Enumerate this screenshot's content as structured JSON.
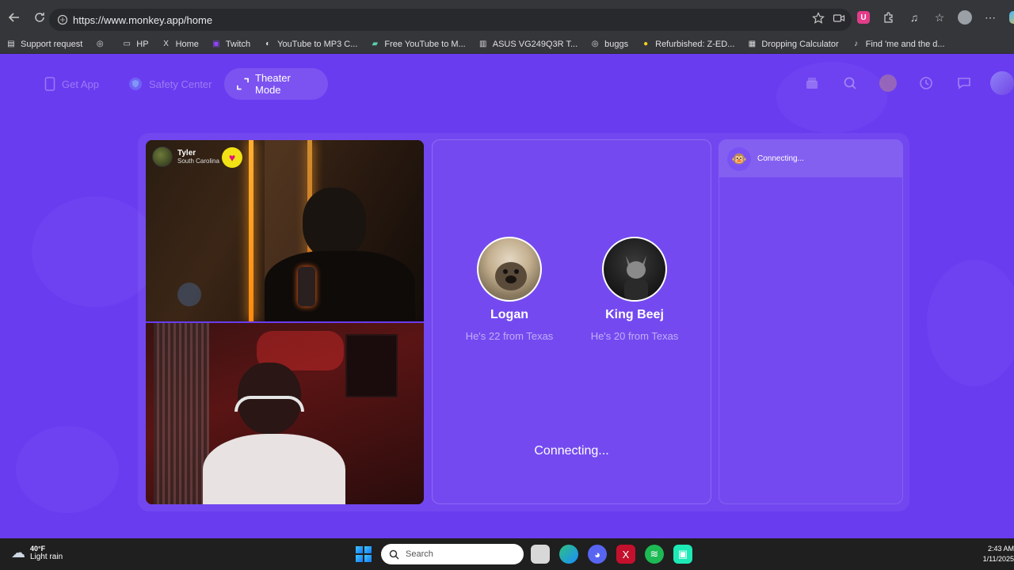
{
  "browser": {
    "url": "https://www.monkey.app/home",
    "bookmarks": [
      {
        "label": "Support request",
        "icon": "ticket-icon"
      },
      {
        "label": "",
        "icon": "globe-icon"
      },
      {
        "label": "HP",
        "icon": "folder-icon"
      },
      {
        "label": "Home",
        "icon": "x-logo-icon"
      },
      {
        "label": "Twitch",
        "icon": "twitch-icon"
      },
      {
        "label": "YouTube to MP3 C...",
        "icon": "converter-icon"
      },
      {
        "label": "Free YouTube to M...",
        "icon": "yt-icon"
      },
      {
        "label": "ASUS VG249Q3R T...",
        "icon": "asus-icon"
      },
      {
        "label": "buggs",
        "icon": "globe-icon"
      },
      {
        "label": "Refurbished: Z-ED...",
        "icon": "ebay-icon"
      },
      {
        "label": "Dropping Calculator",
        "icon": "calculator-icon"
      },
      {
        "label": "Find 'me and the d...",
        "icon": "tiktok-icon"
      }
    ]
  },
  "nav": {
    "get_app": "Get App",
    "safety_center": "Safety Center",
    "theater_mode": "Theater Mode"
  },
  "video": {
    "remote_user": {
      "name": "Tyler",
      "location": "South Carolina"
    }
  },
  "match": {
    "people": [
      {
        "name": "Logan",
        "info": "He's 22 from Texas"
      },
      {
        "name": "King Beej",
        "info": "He's 20 from Texas"
      }
    ],
    "status": "Connecting..."
  },
  "chat": {
    "status": "Connecting..."
  },
  "taskbar": {
    "weather_temp": "40°F",
    "weather_desc": "Light rain",
    "search_placeholder": "Search",
    "time": "2:43 AM",
    "date": "1/11/2025"
  },
  "colors": {
    "page_bg": "#6a3cf0",
    "heart_bg": "#f2e114",
    "heart": "#e0147b"
  }
}
